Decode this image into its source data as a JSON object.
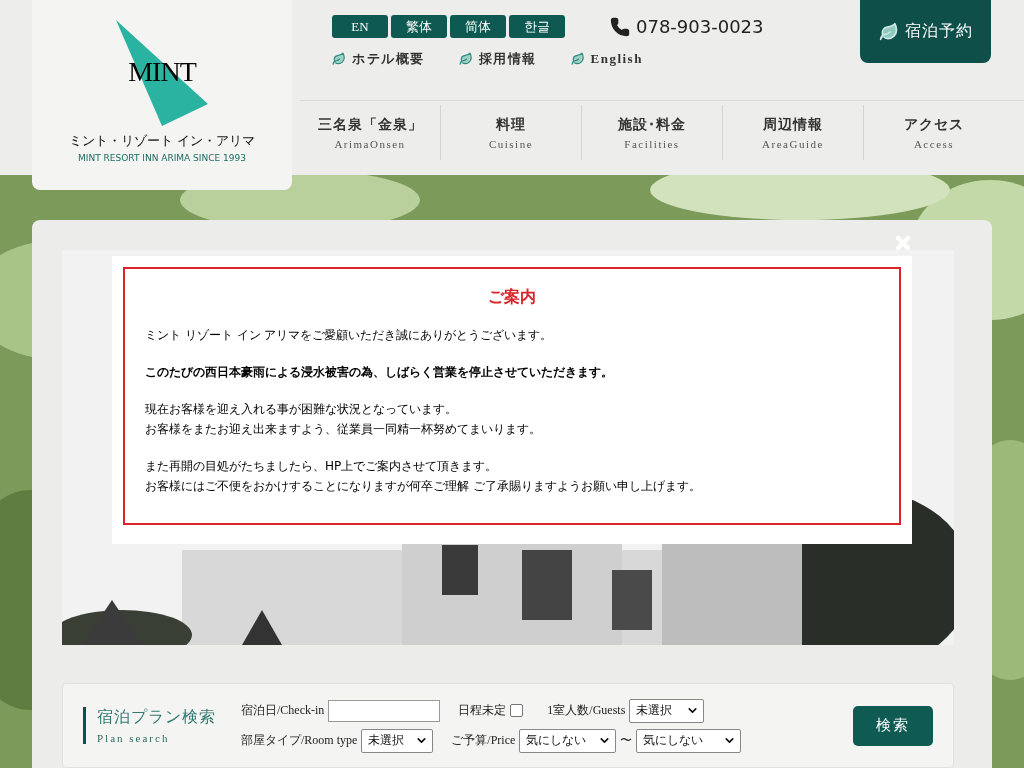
{
  "logo": {
    "wordmark": "MINT",
    "name_ja": "ミント・リゾート イン・アリマ",
    "tagline": "MINT RESORT INN ARIMA SINCE 1993"
  },
  "languages": [
    {
      "label": "EN"
    },
    {
      "label": "繁体"
    },
    {
      "label": "简体"
    },
    {
      "label": "한글"
    }
  ],
  "phone": "078-903-0023",
  "links": [
    {
      "label": "ホテル概要"
    },
    {
      "label": "採用情報"
    },
    {
      "label": "English"
    }
  ],
  "reserve_button": "宿泊予約",
  "nav": [
    {
      "ja": "三名泉「金泉」",
      "en": "ArimaOnsen"
    },
    {
      "ja": "料理",
      "en": "Cuisine"
    },
    {
      "ja": "施設･料金",
      "en": "Facilities"
    },
    {
      "ja": "周辺情報",
      "en": "AreaGuide"
    },
    {
      "ja": "アクセス",
      "en": "Access"
    }
  ],
  "modal": {
    "title": "ご案内",
    "paragraphs": [
      {
        "emphasis": false,
        "lines": [
          "ミント リゾート イン アリマをご愛顧いただき誠にありがとうございます。"
        ]
      },
      {
        "emphasis": true,
        "lines": [
          "このたびの西日本豪雨による浸水被害の為、しばらく営業を停止させていただきます。"
        ]
      },
      {
        "emphasis": false,
        "lines": [
          "現在お客様を迎え入れる事が困難な状況となっています。",
          "お客様をまたお迎え出来ますよう、従業員一同精一杯努めてまいります。"
        ]
      },
      {
        "emphasis": false,
        "lines": [
          "また再開の目処がたちましたら、HP上でご案内させて頂きます。",
          "お客様にはご不便をおかけすることになりますが何卒ご理解 ご了承賜りますようお願い申し上げます。"
        ]
      }
    ]
  },
  "search": {
    "title": "宿泊プラン検索",
    "subtitle": "Plan search",
    "checkin": {
      "label": "宿泊日/Check-in"
    },
    "undecided": {
      "label": "日程未定",
      "checked": false
    },
    "guests": {
      "label": "1室人数/Guests",
      "value": "未選択"
    },
    "room_type": {
      "label": "部屋タイプ/Room type",
      "value": "未選択"
    },
    "price": {
      "label": "ご予算/Price",
      "from": "気にしない",
      "separator": "〜",
      "to": "気にしない"
    },
    "button": "検索"
  }
}
